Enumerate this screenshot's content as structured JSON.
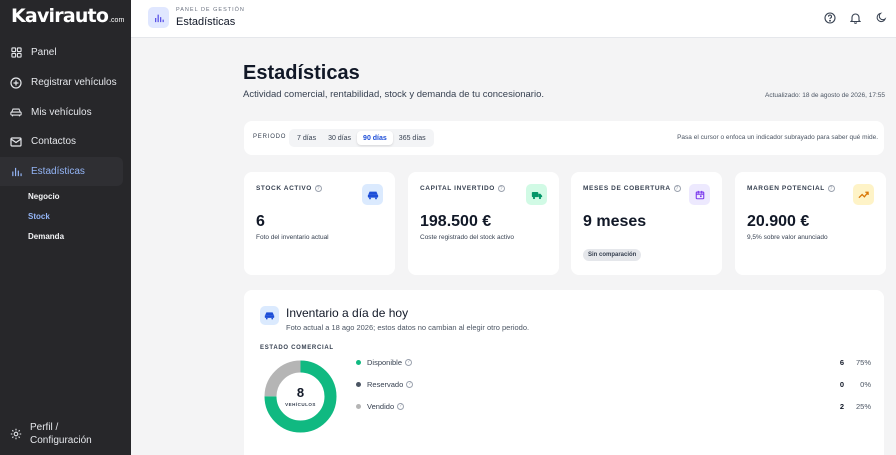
{
  "brand": {
    "name": "Kavirauto",
    "tld": ".com"
  },
  "sidebar": {
    "items": [
      {
        "label": "Panel",
        "icon": "grid-icon"
      },
      {
        "label": "Registrar vehículos",
        "icon": "plus-circle-icon"
      },
      {
        "label": "Mis vehículos",
        "icon": "car-icon"
      },
      {
        "label": "Contactos",
        "icon": "mail-icon"
      },
      {
        "label": "Estadísticas",
        "icon": "bar-chart-icon",
        "active": true
      }
    ],
    "subitems": [
      {
        "label": "Negocio"
      },
      {
        "label": "Stock",
        "active": true
      },
      {
        "label": "Demanda"
      }
    ],
    "profile": {
      "line1": "Perfil /",
      "line2": "Configuración",
      "icon": "gear-icon"
    }
  },
  "topbar": {
    "crumb": "PANEL DE GESTIÓN",
    "title": "Estadísticas",
    "icons": [
      "help-icon",
      "bell-icon",
      "moon-icon"
    ]
  },
  "header": {
    "title": "Estadísticas",
    "subtitle": "Actividad comercial, rentabilidad, stock y demanda de tu concesionario.",
    "updated": "Actualizado: 18 de agosto de 2026, 17:55"
  },
  "period": {
    "label": "PERIODO",
    "options": [
      "7 días",
      "30 días",
      "90 días",
      "365 días"
    ],
    "selected": "90 días",
    "hint": "Pasa el cursor o enfoca un indicador subrayado para saber qué mide."
  },
  "kpis": [
    {
      "label": "STOCK ACTIVO",
      "value": "6",
      "note": "Foto del inventario actual",
      "icon": "car-icon",
      "color": "#dbeafe",
      "fg": "#1d4ed8"
    },
    {
      "label": "CAPITAL INVERTIDO",
      "value": "198.500 €",
      "note": "Coste registrado del stock activo",
      "icon": "truck-icon",
      "color": "#d1fae5",
      "fg": "#059669"
    },
    {
      "label": "MESES DE COBERTURA",
      "value": "9 meses",
      "note": "",
      "chip": "Sin comparación",
      "icon": "calendar-icon",
      "color": "#ede9fe",
      "fg": "#7c3aed"
    },
    {
      "label": "MARGEN POTENCIAL",
      "value": "20.900 €",
      "note": "9,5% sobre valor anunciado",
      "icon": "trend-up-icon",
      "color": "#fef3c7",
      "fg": "#d97706"
    }
  ],
  "inventory": {
    "title": "Inventario a día de hoy",
    "subtitle": "Foto actual a 18 ago 2026; estos datos no cambian al elegir otro periodo.",
    "section": "ESTADO COMERCIAL",
    "total": "8",
    "unit": "VEHÍCULOS",
    "states": [
      {
        "label": "Disponible",
        "count": "6",
        "pct": "75%",
        "share": 0.75,
        "color": "#10b981"
      },
      {
        "label": "Reservado",
        "count": "0",
        "pct": "0%",
        "share": 0,
        "color": "#4b5563"
      },
      {
        "label": "Vendido",
        "count": "2",
        "pct": "25%",
        "share": 0.25,
        "color": "#b5b5b5"
      }
    ]
  }
}
